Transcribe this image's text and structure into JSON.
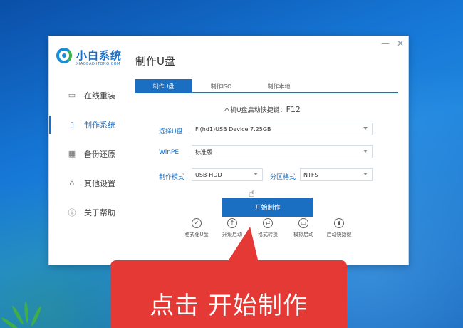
{
  "app": {
    "logo_text": "小白系统",
    "logo_sub": "XIAOBAIXITONG.COM",
    "header_title": "制作U盘",
    "window_controls": [
      "—",
      "✕"
    ]
  },
  "sidebar": {
    "items": [
      {
        "label": "在线重装",
        "icon": "monitor-icon"
      },
      {
        "label": "制作系统",
        "icon": "usb-drive-icon",
        "active": true
      },
      {
        "label": "备份还原",
        "icon": "grid-icon"
      },
      {
        "label": "其他设置",
        "icon": "box-icon"
      },
      {
        "label": "关于帮助",
        "icon": "info-icon"
      }
    ]
  },
  "tabs": [
    {
      "label": "制作U盘",
      "active": true
    },
    {
      "label": "制作ISO"
    },
    {
      "label": "制作本地"
    }
  ],
  "form": {
    "hotkey_prefix": "本机U盘启动快捷键：",
    "hotkey_key": "F12",
    "usb_label": "选择U盘",
    "usb_value": "F:(hd1)USB Device 7.25GB",
    "winpe_label": "WinPE",
    "winpe_value": "标准版",
    "mode_label": "制作模式",
    "mode_value": "USB-HDD",
    "partition_label": "分区格式",
    "partition_value": "NTFS",
    "start_label": "开始制作"
  },
  "tools": [
    {
      "label": "格式化U盘",
      "icon": "check-circle-icon"
    },
    {
      "label": "升级启动",
      "icon": "upload-circle-icon"
    },
    {
      "label": "格式转换",
      "icon": "convert-icon"
    },
    {
      "label": "模拟启动",
      "icon": "computer-icon"
    },
    {
      "label": "启动快捷键",
      "icon": "mouse-icon"
    }
  ],
  "callout": {
    "text": "点击 开始制作"
  },
  "colors": {
    "accent": "#1b6fc2",
    "callout": "#e53935"
  }
}
